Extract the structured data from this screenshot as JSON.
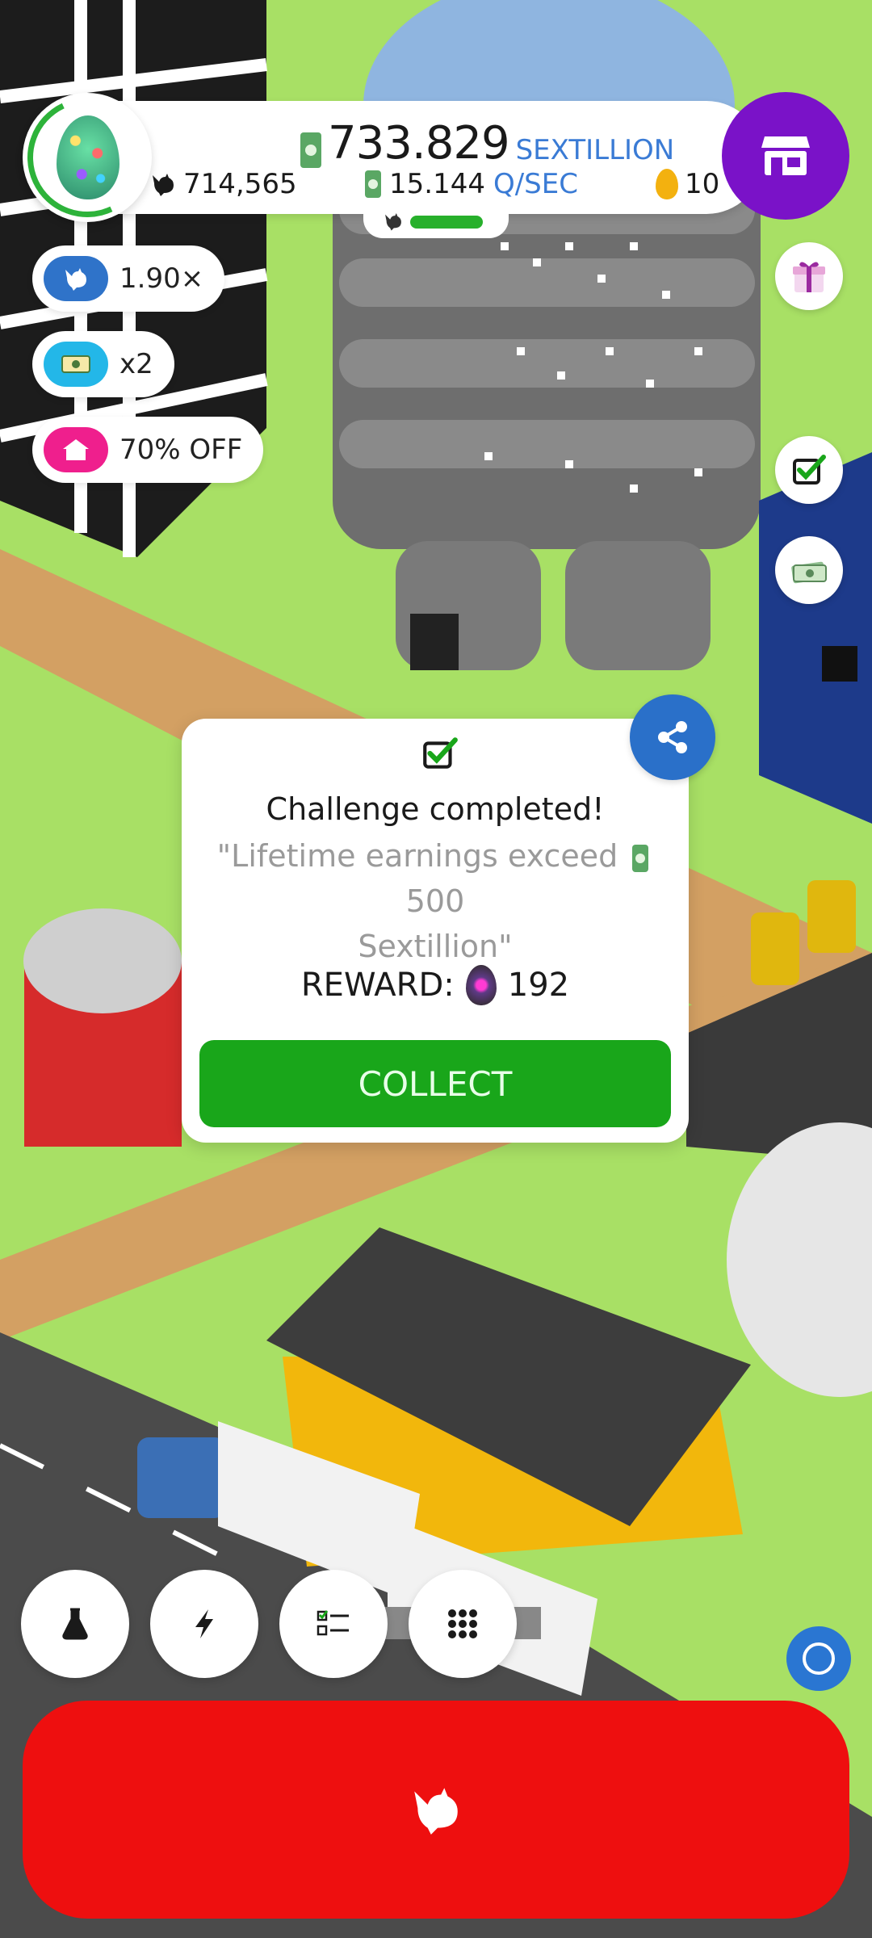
{
  "hud": {
    "money_value": "733.829",
    "money_unit": "SEXTILLION",
    "chicken_count": "714,565",
    "rate_value": "15.144",
    "rate_unit": "Q/SEC",
    "golden_eggs": "10"
  },
  "boosts": [
    {
      "label": "1.90×",
      "icon": "chicken-icon",
      "color": "#2f73c9"
    },
    {
      "label": "x2",
      "icon": "money-boost-icon",
      "color": "#23b7e8"
    },
    {
      "label": "70% OFF",
      "icon": "house-icon",
      "color": "#ef1f8d"
    }
  ],
  "dialog": {
    "title": "Challenge completed!",
    "quote_start": "\"Lifetime earnings exceed",
    "quote_amount": "500",
    "quote_end": "Sextillion\"",
    "reward_label": "REWARD:",
    "reward_value": "192",
    "collect_label": "COLLECT"
  },
  "bottom_buttons": [
    "research-icon",
    "boost-icon",
    "missions-icon",
    "menu-grid-icon"
  ],
  "colors": {
    "shop": "#7a12c8",
    "hatch": "#ee0f0f",
    "collect": "#19a61a",
    "share": "#2a70c9",
    "accent_blue": "#3a7bd5"
  }
}
